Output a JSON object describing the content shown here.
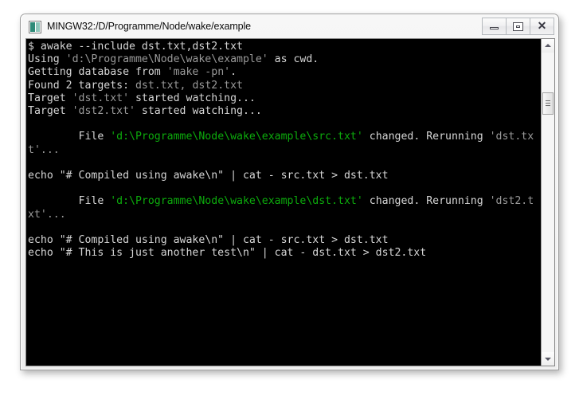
{
  "window": {
    "title": "MINGW32:/D/Programme/Node/wake/example",
    "icon": "mingw-icon",
    "controls": {
      "minimize_label": "Minimize",
      "maximize_label": "Maximize",
      "close_label": "✕"
    }
  },
  "colors": {
    "terminal_background": "#000000",
    "text_white": "#d6d6d6",
    "text_gray": "#9a9a9a",
    "text_green": "#0cab0c",
    "titlebar_background": "#f0f0f0",
    "window_border": "#9a9a9a"
  },
  "terminal": {
    "prompt": "$",
    "command": "awake --include dst.txt,dst2.txt",
    "lines": [
      {
        "id": "line-command",
        "segments": [
          {
            "text": "$ awake --include dst.txt,dst2.txt",
            "color": "c-white"
          }
        ]
      },
      {
        "id": "line-using",
        "segments": [
          {
            "text": "Using ",
            "color": "c-white"
          },
          {
            "text": "'d:\\Programme\\Node\\wake\\example'",
            "color": "c-gray"
          },
          {
            "text": " as cwd.",
            "color": "c-white"
          }
        ]
      },
      {
        "id": "line-getting",
        "segments": [
          {
            "text": "Getting database from ",
            "color": "c-white"
          },
          {
            "text": "'make -pn'",
            "color": "c-gray"
          },
          {
            "text": ".",
            "color": "c-white"
          }
        ]
      },
      {
        "id": "line-found",
        "segments": [
          {
            "text": "Found 2 targets: ",
            "color": "c-white"
          },
          {
            "text": "dst.txt, dst2.txt",
            "color": "c-gray"
          }
        ]
      },
      {
        "id": "line-target1",
        "segments": [
          {
            "text": "Target ",
            "color": "c-white"
          },
          {
            "text": "'dst.txt'",
            "color": "c-gray"
          },
          {
            "text": " started watching...",
            "color": "c-white"
          }
        ]
      },
      {
        "id": "line-target2",
        "segments": [
          {
            "text": "Target ",
            "color": "c-white"
          },
          {
            "text": "'dst2.txt'",
            "color": "c-gray"
          },
          {
            "text": " started watching...",
            "color": "c-white"
          }
        ]
      },
      {
        "id": "line-blank-1",
        "segments": [
          {
            "text": " ",
            "color": "c-white"
          }
        ]
      },
      {
        "id": "line-file1",
        "segments": [
          {
            "text": "        File ",
            "color": "c-white"
          },
          {
            "text": "'d:\\Programme\\Node\\wake\\example\\src.txt'",
            "color": "c-green"
          },
          {
            "text": " changed. Rerunning ",
            "color": "c-white"
          },
          {
            "text": "'dst.tx",
            "color": "c-gray"
          }
        ]
      },
      {
        "id": "line-file1-wrap",
        "segments": [
          {
            "text": "t'...",
            "color": "c-gray"
          }
        ]
      },
      {
        "id": "line-blank-2",
        "segments": [
          {
            "text": " ",
            "color": "c-white"
          }
        ]
      },
      {
        "id": "line-echo1",
        "segments": [
          {
            "text": "echo \"# Compiled using awake\\n\" | cat - src.txt > dst.txt",
            "color": "c-white"
          }
        ]
      },
      {
        "id": "line-blank-3",
        "segments": [
          {
            "text": " ",
            "color": "c-white"
          }
        ]
      },
      {
        "id": "line-file2",
        "segments": [
          {
            "text": "        File ",
            "color": "c-white"
          },
          {
            "text": "'d:\\Programme\\Node\\wake\\example\\dst.txt'",
            "color": "c-green"
          },
          {
            "text": " changed. Rerunning ",
            "color": "c-white"
          },
          {
            "text": "'dst2.t",
            "color": "c-gray"
          }
        ]
      },
      {
        "id": "line-file2-wrap",
        "segments": [
          {
            "text": "xt'...",
            "color": "c-gray"
          }
        ]
      },
      {
        "id": "line-blank-4",
        "segments": [
          {
            "text": " ",
            "color": "c-white"
          }
        ]
      },
      {
        "id": "line-echo2",
        "segments": [
          {
            "text": "echo \"# Compiled using awake\\n\" | cat - src.txt > dst.txt",
            "color": "c-white"
          }
        ]
      },
      {
        "id": "line-echo3",
        "segments": [
          {
            "text": "echo \"# This is just another test\\n\" | cat - dst.txt > dst2.txt",
            "color": "c-white"
          }
        ]
      }
    ]
  },
  "scrollbar": {
    "up_arrow": "scroll-up-arrow",
    "down_arrow": "scroll-down-arrow",
    "thumb": "scroll-thumb"
  }
}
